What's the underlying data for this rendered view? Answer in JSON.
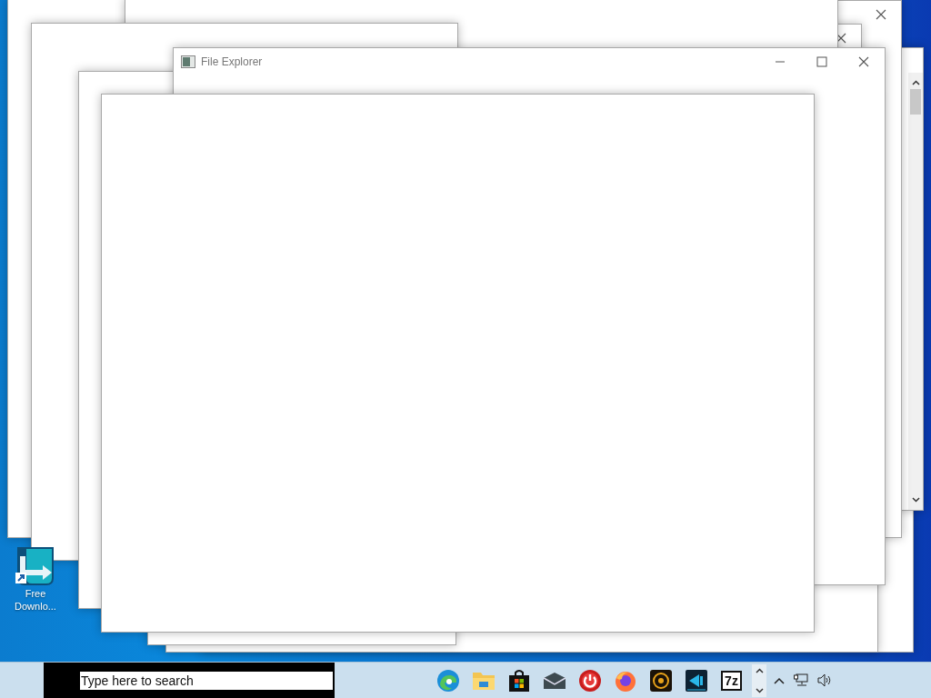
{
  "desktop": {
    "icons": [
      {
        "label": "Free Downlo..."
      }
    ]
  },
  "windows": [
    {
      "title": "File Explorer"
    }
  ],
  "taskbar": {
    "search": {
      "placeholder": "Type here to search"
    },
    "apps": [
      {
        "kind": "edge"
      },
      {
        "kind": "folder"
      },
      {
        "kind": "store"
      },
      {
        "kind": "mail"
      },
      {
        "kind": "power"
      },
      {
        "kind": "firefox"
      },
      {
        "kind": "reel"
      },
      {
        "kind": "director"
      },
      {
        "kind": "archive",
        "label": "7z"
      }
    ]
  }
}
